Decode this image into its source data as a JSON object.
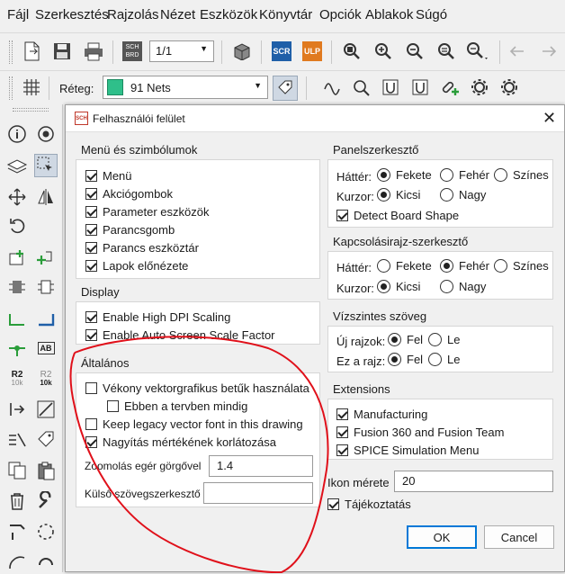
{
  "menu": [
    "Fájl",
    "Szerkesztés",
    "Rajzolás",
    "Nézet",
    "Eszközök",
    "Könyvtár",
    "Opciók",
    "Ablakok",
    "Súgó"
  ],
  "toolbar": {
    "sheet_select": "1/1",
    "scr_label": "SCR",
    "ulp_label": "ULP",
    "sch_brd_label": "SCH BRD",
    "layer_label": "Réteg:",
    "layer_value": "91 Nets",
    "layer_color": "#2fbf8a"
  },
  "left_toolbar": {
    "r2_10k_a": "R2",
    "r2_10k_a_sub": "10k",
    "r2_10k_b": "R2",
    "r2_10k_b_sub": "10k",
    "ab_label": "AB"
  },
  "dialog": {
    "title": "Felhasználói felület",
    "app_icon_text": "SCH",
    "groups": {
      "menus": {
        "title": "Menü és szimbólumok",
        "items": [
          {
            "label": "Menü",
            "checked": true
          },
          {
            "label": "Akciógombok",
            "checked": true
          },
          {
            "label": "Parameter eszközök",
            "checked": true
          },
          {
            "label": "Parancsgomb",
            "checked": true
          },
          {
            "label": "Parancs eszköztár",
            "checked": true
          },
          {
            "label": "Lapok előnézete",
            "checked": true
          }
        ]
      },
      "display": {
        "title": "Display",
        "items": [
          {
            "label": "Enable High DPI Scaling",
            "checked": true
          },
          {
            "label": "Enable Auto Screen Scale Factor",
            "checked": true
          }
        ]
      },
      "general": {
        "title": "Általános",
        "items": [
          {
            "label": "Vékony vektorgrafikus betűk használata",
            "checked": false
          },
          {
            "label": "Ebben a tervben mindig",
            "checked": false
          },
          {
            "label": "Keep legacy vector font in this drawing",
            "checked": false
          },
          {
            "label": "Nagyítás mértékének korlátozása",
            "checked": true
          }
        ],
        "zoom_label": "Zoomolás egér görgővel",
        "zoom_value": "1.4",
        "editor_label": "Külső szövegszerkesztő",
        "editor_value": ""
      },
      "panel_editor": {
        "title": "Panelszerkesztő",
        "background_label": "Háttér:",
        "background_options": [
          "Fekete",
          "Fehér",
          "Színes"
        ],
        "background_selected": "Fekete",
        "cursor_label": "Kurzor:",
        "cursor_options": [
          "Kicsi",
          "Nagy"
        ],
        "cursor_selected": "Kicsi",
        "detect_label": "Detect Board Shape",
        "detect_checked": true
      },
      "schematic_editor": {
        "title": "Kapcsolásirajz-szerkesztő",
        "background_label": "Háttér:",
        "background_options": [
          "Fekete",
          "Fehér",
          "Színes"
        ],
        "background_selected": "Fehér",
        "cursor_label": "Kurzor:",
        "cursor_options": [
          "Kicsi",
          "Nagy"
        ],
        "cursor_selected": "Kicsi"
      },
      "horizontal_text": {
        "title": "Vízszintes szöveg",
        "new_label": "Új rajzok:",
        "this_label": "Ez a rajz:",
        "options": [
          "Fel",
          "Le"
        ],
        "new_selected": "Fel",
        "this_selected": "Fel"
      },
      "extensions": {
        "title": "Extensions",
        "items": [
          {
            "label": "Manufacturing",
            "checked": true
          },
          {
            "label": "Fusion 360 and Fusion Team",
            "checked": true
          },
          {
            "label": "SPICE Simulation Menu",
            "checked": true
          }
        ]
      }
    },
    "icon_size_label": "Ikon mérete",
    "icon_size_value": "20",
    "info_label": "Tájékoztatás",
    "info_checked": true,
    "ok_label": "OK",
    "cancel_label": "Cancel",
    "annotation_color": "#e0101a"
  }
}
